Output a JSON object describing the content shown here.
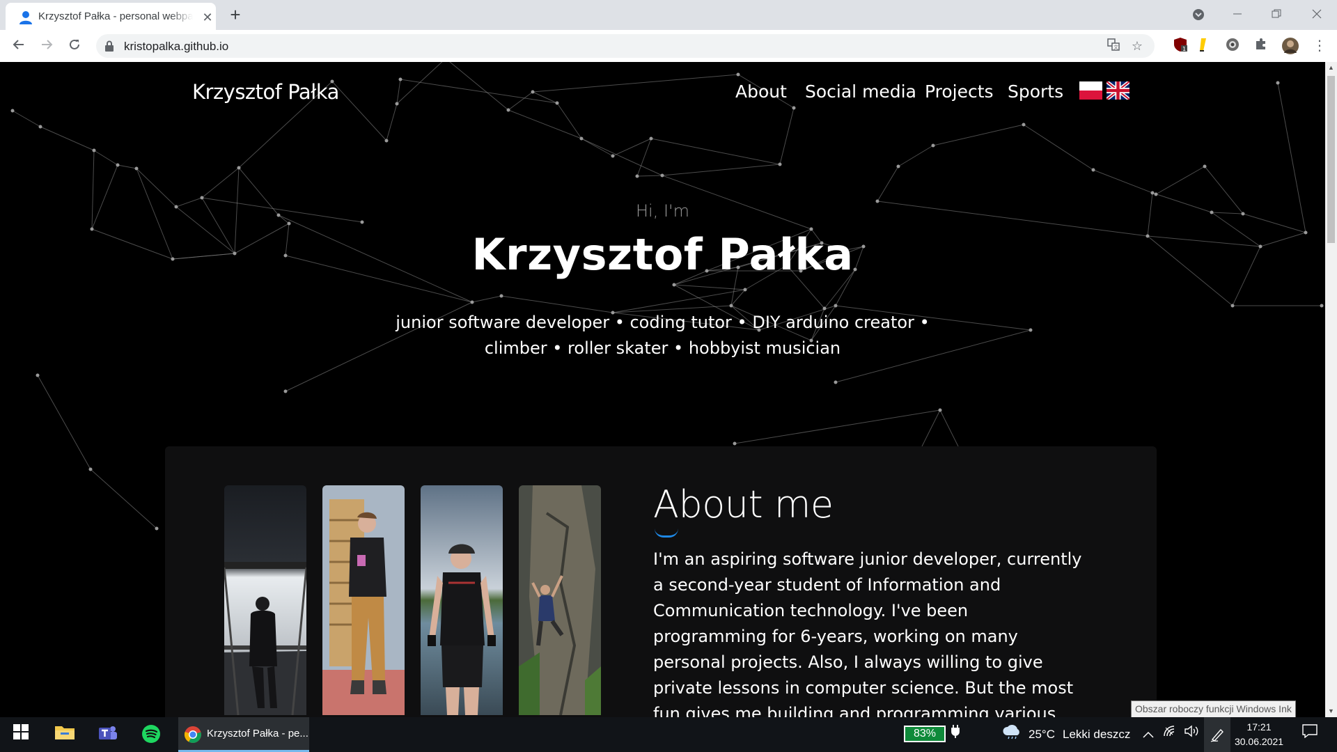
{
  "browser": {
    "tab_title": "Krzysztof Pałka - personal webpage",
    "tab_close": "✕",
    "new_tab": "+",
    "url": "kristopalka.github.io",
    "extensions": [
      "ublock-icon",
      "lingq-icon",
      "camera-icon",
      "puzzle-icon",
      "profile-avatar"
    ],
    "extension_badge": "1"
  },
  "site": {
    "brand": "Krzysztof Pałka",
    "menu": [
      "About",
      "Social media",
      "Projects",
      "Sports"
    ],
    "languages": [
      "pl",
      "en"
    ]
  },
  "hero": {
    "greeting": "Hi, I'm",
    "name": "Krzysztof Pałka",
    "tagline_line1": "junior software developer • coding tutor • DIY arduino creator •",
    "tagline_line2": "climber • roller skater • hobbyist musician"
  },
  "about": {
    "title": "About me",
    "text": "I'm an aspiring software junior developer, currently a second-year student of Information and Communication technology. I've been programming for 6-years, working on many personal projects. Also, I always willing to give private lessons in computer science. But the most fun gives me building and programming various gadgets based on",
    "photos": [
      "photo-on-bridge",
      "photo-gym-mirror",
      "photo-roller-skating",
      "photo-rock-climbing"
    ]
  },
  "tooltip": "Obszar roboczy funkcji Windows Ink",
  "taskbar": {
    "chrome_label": "Krzysztof Pałka - pe...",
    "battery": "83%",
    "weather_temp": "25°C",
    "weather_desc": "Lekki deszcz",
    "time": "17:21",
    "date": "30.06.2021"
  },
  "colors": {
    "accent_blue": "#1e88e5",
    "page_bg": "#000000",
    "card_bg": "#0f0f10",
    "battery_green": "#0f8a3a"
  }
}
